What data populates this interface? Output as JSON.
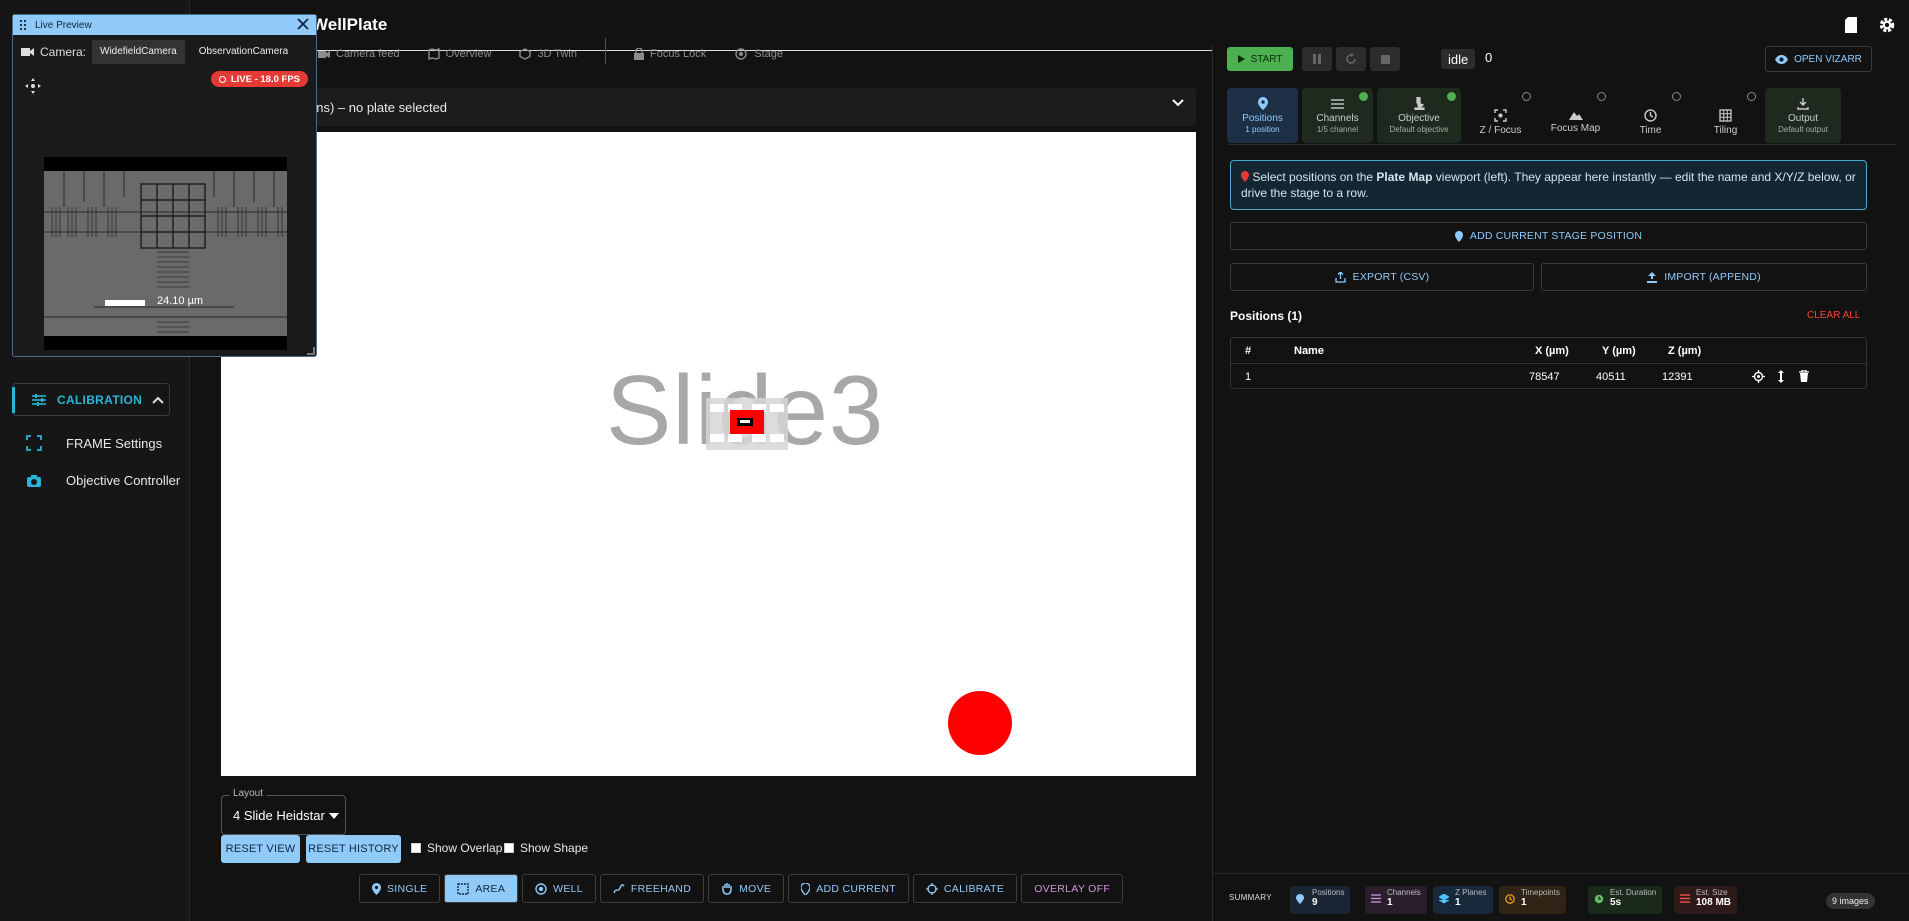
{
  "app": {
    "title": "WellPlate"
  },
  "sidebar": {
    "section": "CALIBRATION",
    "items": [
      {
        "label": "FRAME Settings",
        "icon": "crop-frame-icon"
      },
      {
        "label": "Objective Controller",
        "icon": "camera-icon"
      }
    ]
  },
  "center": {
    "tabs": [
      {
        "label": "Camera feed",
        "icon": "camera-icon"
      },
      {
        "label": "Overview",
        "icon": "map-icon"
      },
      {
        "label": "3D Twin",
        "icon": "cube-icon"
      },
      {
        "label": "Focus Lock",
        "icon": "lock-icon"
      },
      {
        "label": "Stage",
        "icon": "stage-icon"
      }
    ],
    "plate_header": "ons) – no plate selected",
    "slide_label": "Slide3",
    "layout": {
      "label": "Layout",
      "value": "4 Slide Heidstar"
    },
    "reset_view": "RESET VIEW",
    "reset_history": "RESET HISTORY",
    "show_overlap": "Show Overlap",
    "show_shape": "Show Shape",
    "modes": [
      "SINGLE",
      "AREA",
      "WELL",
      "FREEHAND",
      "MOVE",
      "ADD CURRENT",
      "CALIBRATE",
      "OVERLAY OFF"
    ],
    "active_mode": "AREA"
  },
  "preview": {
    "title": "Live Preview",
    "camera_label": "Camera:",
    "cameras": [
      "WidefieldCamera",
      "ObservationCamera"
    ],
    "selected_camera": "WidefieldCamera",
    "live_badge": "LIVE - 18.0 FPS",
    "scale": "24.10 µm"
  },
  "right": {
    "start": "START",
    "status": "idle",
    "count": "0",
    "open_vizarr": "OPEN VIZARR",
    "tabs": [
      {
        "name": "Positions",
        "sub": "1 position",
        "state": "selected"
      },
      {
        "name": "Channels",
        "sub": "1/5 channel",
        "state": "done"
      },
      {
        "name": "Objective",
        "sub": "Default objective",
        "state": "done"
      },
      {
        "name": "Z / Focus",
        "sub": "",
        "state": "todo"
      },
      {
        "name": "Focus Map",
        "sub": "",
        "state": "todo"
      },
      {
        "name": "Time",
        "sub": "",
        "state": "todo"
      },
      {
        "name": "Tiling",
        "sub": "",
        "state": "todo"
      },
      {
        "name": "Output",
        "sub": "Default output",
        "state": "done"
      }
    ],
    "info": {
      "pre": "Select positions on the ",
      "bold": "Plate Map",
      "post": " viewport (left). They appear here instantly — edit the name and X/Y/Z below, or drive the stage to a row."
    },
    "add_stage": "ADD CURRENT STAGE POSITION",
    "export": "EXPORT (CSV)",
    "import": "IMPORT (APPEND)",
    "positions_title": "Positions (1)",
    "clear_all": "CLEAR ALL",
    "table": {
      "headers": [
        "#",
        "Name",
        "X (µm)",
        "Y (µm)",
        "Z (µm)"
      ],
      "rows": [
        {
          "n": "1",
          "name": "",
          "x": "78547",
          "y": "40511",
          "z": "12391"
        }
      ]
    },
    "summary": {
      "label": "SUMMARY",
      "chips": [
        {
          "label": "Positions",
          "value": "9",
          "color": "#90caf9"
        },
        {
          "label": "Channels",
          "value": "1",
          "color": "#ce93d8"
        },
        {
          "label": "Z Planes",
          "value": "1",
          "color": "#4fc3f7"
        },
        {
          "label": "Timepoints",
          "value": "1",
          "color": "#ffa726"
        },
        {
          "label": "Est. Duration",
          "value": "5s",
          "color": "#66bb6a"
        },
        {
          "label": "Est. Size",
          "value": "108 MB",
          "color": "#ef5350"
        }
      ],
      "images": "9 images"
    }
  },
  "colors": {
    "accent": "#90caf9",
    "calibration": "#29b6d6",
    "live": "#e53935",
    "start": "#4caf50"
  }
}
